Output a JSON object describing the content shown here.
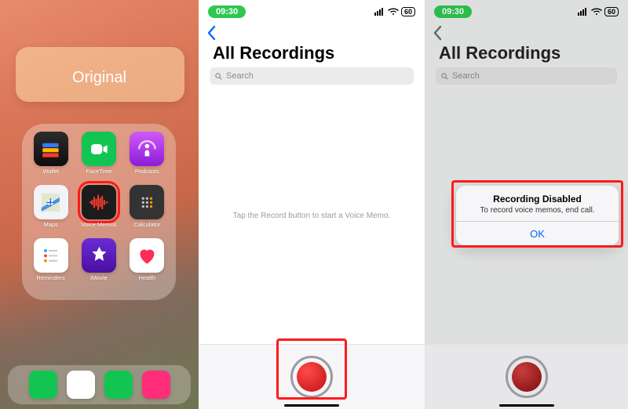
{
  "panel1": {
    "folder_title": "Original",
    "apps": [
      {
        "name": "Wallet"
      },
      {
        "name": "FaceTime"
      },
      {
        "name": "Podcasts"
      },
      {
        "name": "Maps"
      },
      {
        "name": "Voice Memos"
      },
      {
        "name": "Calculator"
      },
      {
        "name": "Reminders"
      },
      {
        "name": "iMovie"
      },
      {
        "name": "Health"
      }
    ]
  },
  "panel2": {
    "time": "09:30",
    "battery": "60",
    "title": "All Recordings",
    "search_placeholder": "Search",
    "hint": "Tap the Record button to start a Voice Memo."
  },
  "panel3": {
    "time": "09:30",
    "battery": "60",
    "title": "All Recordings",
    "search_placeholder": "Search",
    "alert": {
      "title": "Recording Disabled",
      "message": "To record voice memos, end call.",
      "ok": "OK"
    }
  }
}
